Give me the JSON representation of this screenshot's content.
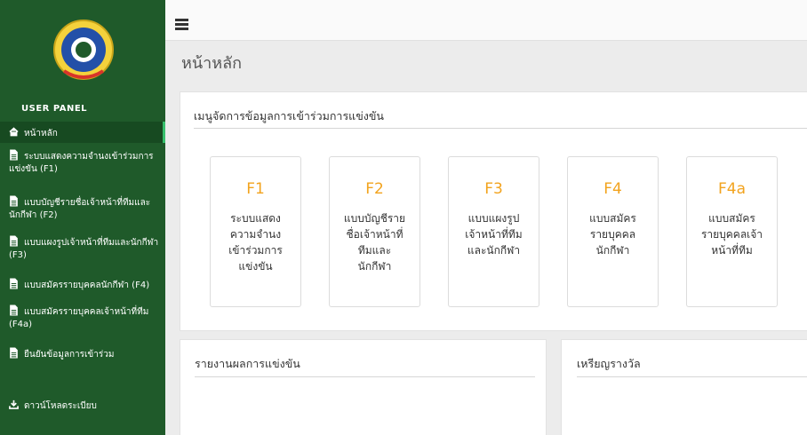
{
  "sidebar": {
    "panel_title": "USER PANEL",
    "items": [
      {
        "label": "หน้าหลัก"
      },
      {
        "label": "ระบบแสดงความจำนงเข้าร่วมการแข่งขัน (F1)"
      },
      {
        "label": "แบบบัญชีรายชื่อเจ้าหน้าที่ทีมและนักกีฬา (F2)"
      },
      {
        "label": "แบบแผงรูปเจ้าหน้าที่ทีมและนักกีฬา (F3)"
      },
      {
        "label": "แบบสมัครรายบุคคลนักกีฬา (F4)"
      },
      {
        "label": "แบบสมัครรายบุคคลเจ้าหน้าที่ทีม (F4a)"
      },
      {
        "label": "ยืนยันข้อมูลการเข้าร่วม"
      },
      {
        "label": "ดาวน์โหลดระเบียบ"
      }
    ]
  },
  "header": {
    "title": "หน้าหลัก"
  },
  "menu_panel": {
    "title": "เมนูจัดการข้อมูลการเข้าร่วมการแข่งขัน",
    "cards": [
      {
        "code": "F1",
        "text": "ระบบแสดง\nความจำนง\nเข้าร่วมการ\nแข่งขัน"
      },
      {
        "code": "F2",
        "text": "แบบบัญชีราย\nชื่อเจ้าหน้าที่\nทีมและ\nนักกีฬา"
      },
      {
        "code": "F3",
        "text": "แบบแผงรูป\nเจ้าหน้าที่ทีม\nและนักกีฬา"
      },
      {
        "code": "F4",
        "text": "แบบสมัคร\nรายบุคคล\nนักกีฬา"
      },
      {
        "code": "F4a",
        "text": "แบบสมัคร\nรายบุคคลเจ้า\nหน้าที่ทีม"
      }
    ]
  },
  "results_panel": {
    "title": "รายงานผลการแข่งขัน"
  },
  "medals_panel": {
    "title": "เหรียญรางวัล"
  },
  "colors": {
    "sidebar": "#1f5a2a",
    "accent": "#f2a31e",
    "active_bar": "#37c06d"
  }
}
